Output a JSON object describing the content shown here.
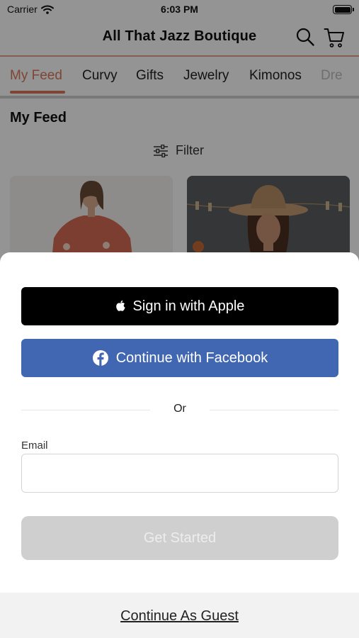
{
  "status_bar": {
    "carrier": "Carrier",
    "time": "6:03 PM"
  },
  "header": {
    "title": "All That Jazz Boutique",
    "search_icon": "search-icon",
    "cart_icon": "cart-icon"
  },
  "category_tabs": [
    {
      "label": "My Feed",
      "active": true
    },
    {
      "label": "Curvy"
    },
    {
      "label": "Gifts"
    },
    {
      "label": "Jewelry"
    },
    {
      "label": "Kimonos"
    },
    {
      "label": "Dre"
    }
  ],
  "feed": {
    "title": "My Feed",
    "filter_label": "Filter",
    "filter_icon": "sliders-icon"
  },
  "sheet": {
    "apple_button": "Sign in with Apple",
    "facebook_button": "Continue with Facebook",
    "divider_text": "Or",
    "email_label": "Email",
    "email_value": "",
    "email_placeholder": "",
    "primary_button": "Get Started",
    "guest_link": "Continue As Guest"
  },
  "colors": {
    "accent": "#d9785c",
    "facebook_blue": "#4267b2",
    "apple_black": "#000000",
    "disabled_button": "#cfcfcf"
  }
}
